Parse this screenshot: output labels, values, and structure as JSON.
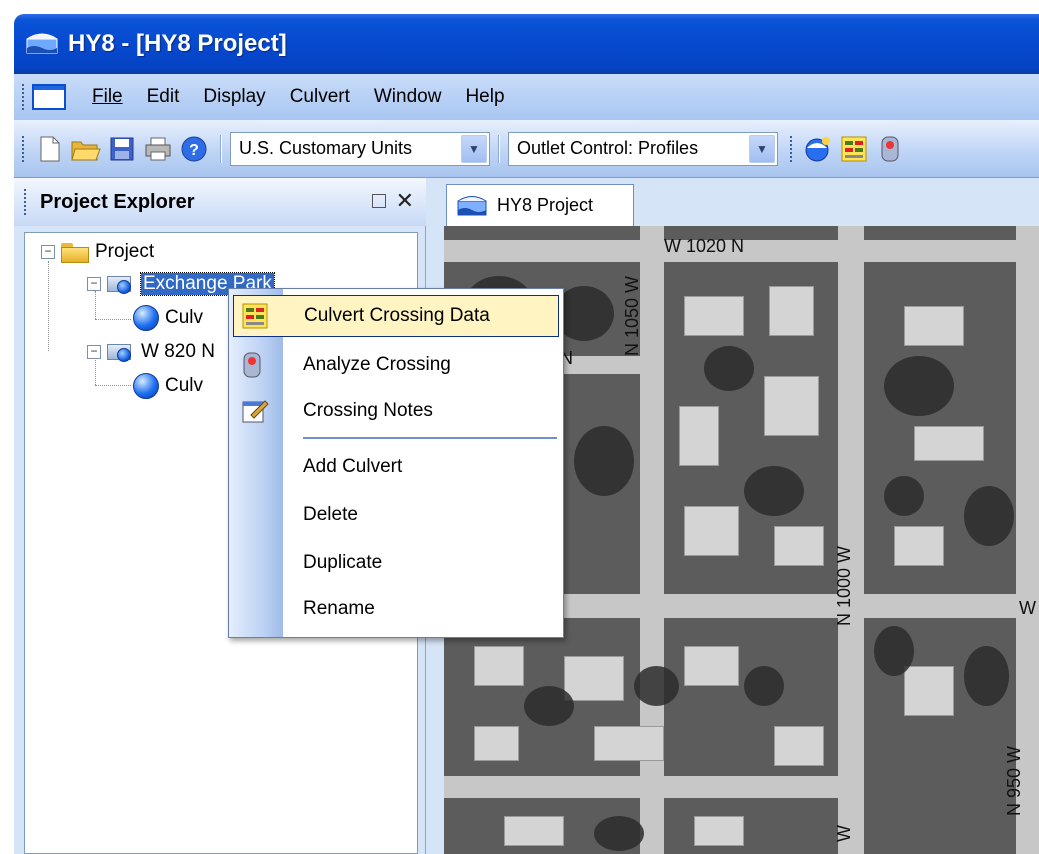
{
  "window": {
    "title": "HY8 - [HY8 Project]"
  },
  "menu": {
    "items": [
      "File",
      "Edit",
      "Display",
      "Culvert",
      "Window",
      "Help"
    ]
  },
  "toolbar": {
    "units": "U.S. Customary Units",
    "outlet": "Outlet Control: Profiles"
  },
  "project_explorer": {
    "title": "Project Explorer",
    "tree": {
      "root": "Project",
      "crossing1": "Exchange Park",
      "crossing1_child": "Culv",
      "crossing2": "W 820 N",
      "crossing2_child": "Culv"
    }
  },
  "document": {
    "tab_title": "HY8 Project",
    "streets": {
      "s1": "W 1020 N",
      "s2": "N 1050 W",
      "s3": "N 1000 W",
      "s4": "N 950 W",
      "s5": "W",
      "s6": "N",
      "s7": "W"
    }
  },
  "context_menu": {
    "items": [
      {
        "label": "Culvert Crossing Data",
        "icon": "crossing-data-icon"
      },
      {
        "label": "Analyze Crossing",
        "icon": "analyze-icon"
      },
      {
        "label": "Crossing Notes",
        "icon": "notes-icon"
      },
      {
        "label": "Add Culvert"
      },
      {
        "label": "Delete"
      },
      {
        "label": "Duplicate"
      },
      {
        "label": "Rename"
      }
    ]
  },
  "colors": {
    "titlebar": "#0649cf",
    "menu_highlight": "#fff4c2",
    "selection": "#316ac5"
  }
}
